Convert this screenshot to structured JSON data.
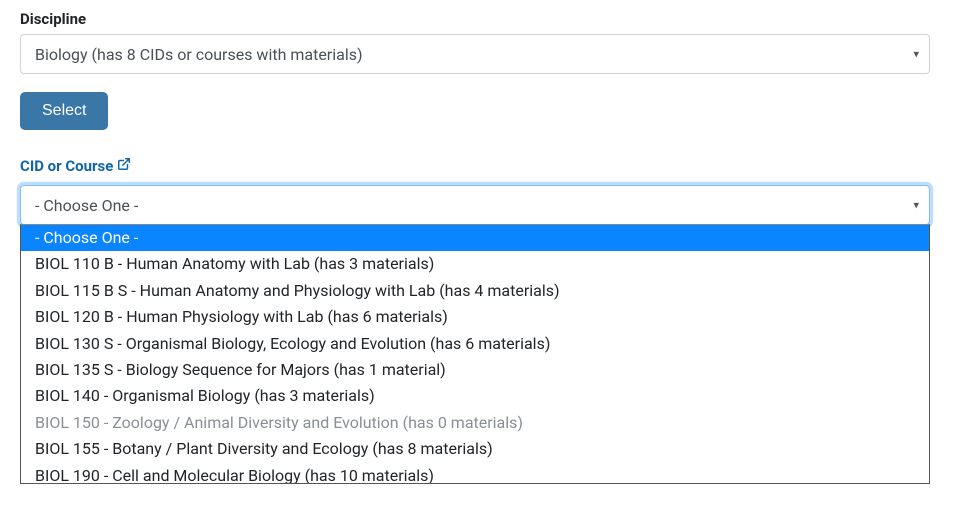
{
  "discipline": {
    "label": "Discipline",
    "selected": "Biology (has 8 CIDs or courses with materials)"
  },
  "select_button": "Select",
  "course": {
    "label": "CID or Course",
    "selected": "- Choose One -",
    "options": [
      {
        "label": "- Choose One -",
        "highlighted": true,
        "disabled": false
      },
      {
        "label": "BIOL 110 B - Human Anatomy with Lab (has 3 materials)",
        "highlighted": false,
        "disabled": false
      },
      {
        "label": "BIOL 115 B S - Human Anatomy and Physiology with Lab (has 4 materials)",
        "highlighted": false,
        "disabled": false
      },
      {
        "label": "BIOL 120 B - Human Physiology with Lab (has 6 materials)",
        "highlighted": false,
        "disabled": false
      },
      {
        "label": "BIOL 130 S - Organismal Biology, Ecology and Evolution (has 6 materials)",
        "highlighted": false,
        "disabled": false
      },
      {
        "label": "BIOL 135 S - Biology Sequence for Majors (has 1 material)",
        "highlighted": false,
        "disabled": false
      },
      {
        "label": "BIOL 140 - Organismal Biology (has 3 materials)",
        "highlighted": false,
        "disabled": false
      },
      {
        "label": "BIOL 150 - Zoology / Animal Diversity and Evolution (has 0 materials)",
        "highlighted": false,
        "disabled": true
      },
      {
        "label": "BIOL 155 - Botany / Plant Diversity and Ecology (has 8 materials)",
        "highlighted": false,
        "disabled": false
      },
      {
        "label": "BIOL 190 - Cell and Molecular Biology (has 10 materials)",
        "highlighted": false,
        "disabled": false
      }
    ]
  }
}
